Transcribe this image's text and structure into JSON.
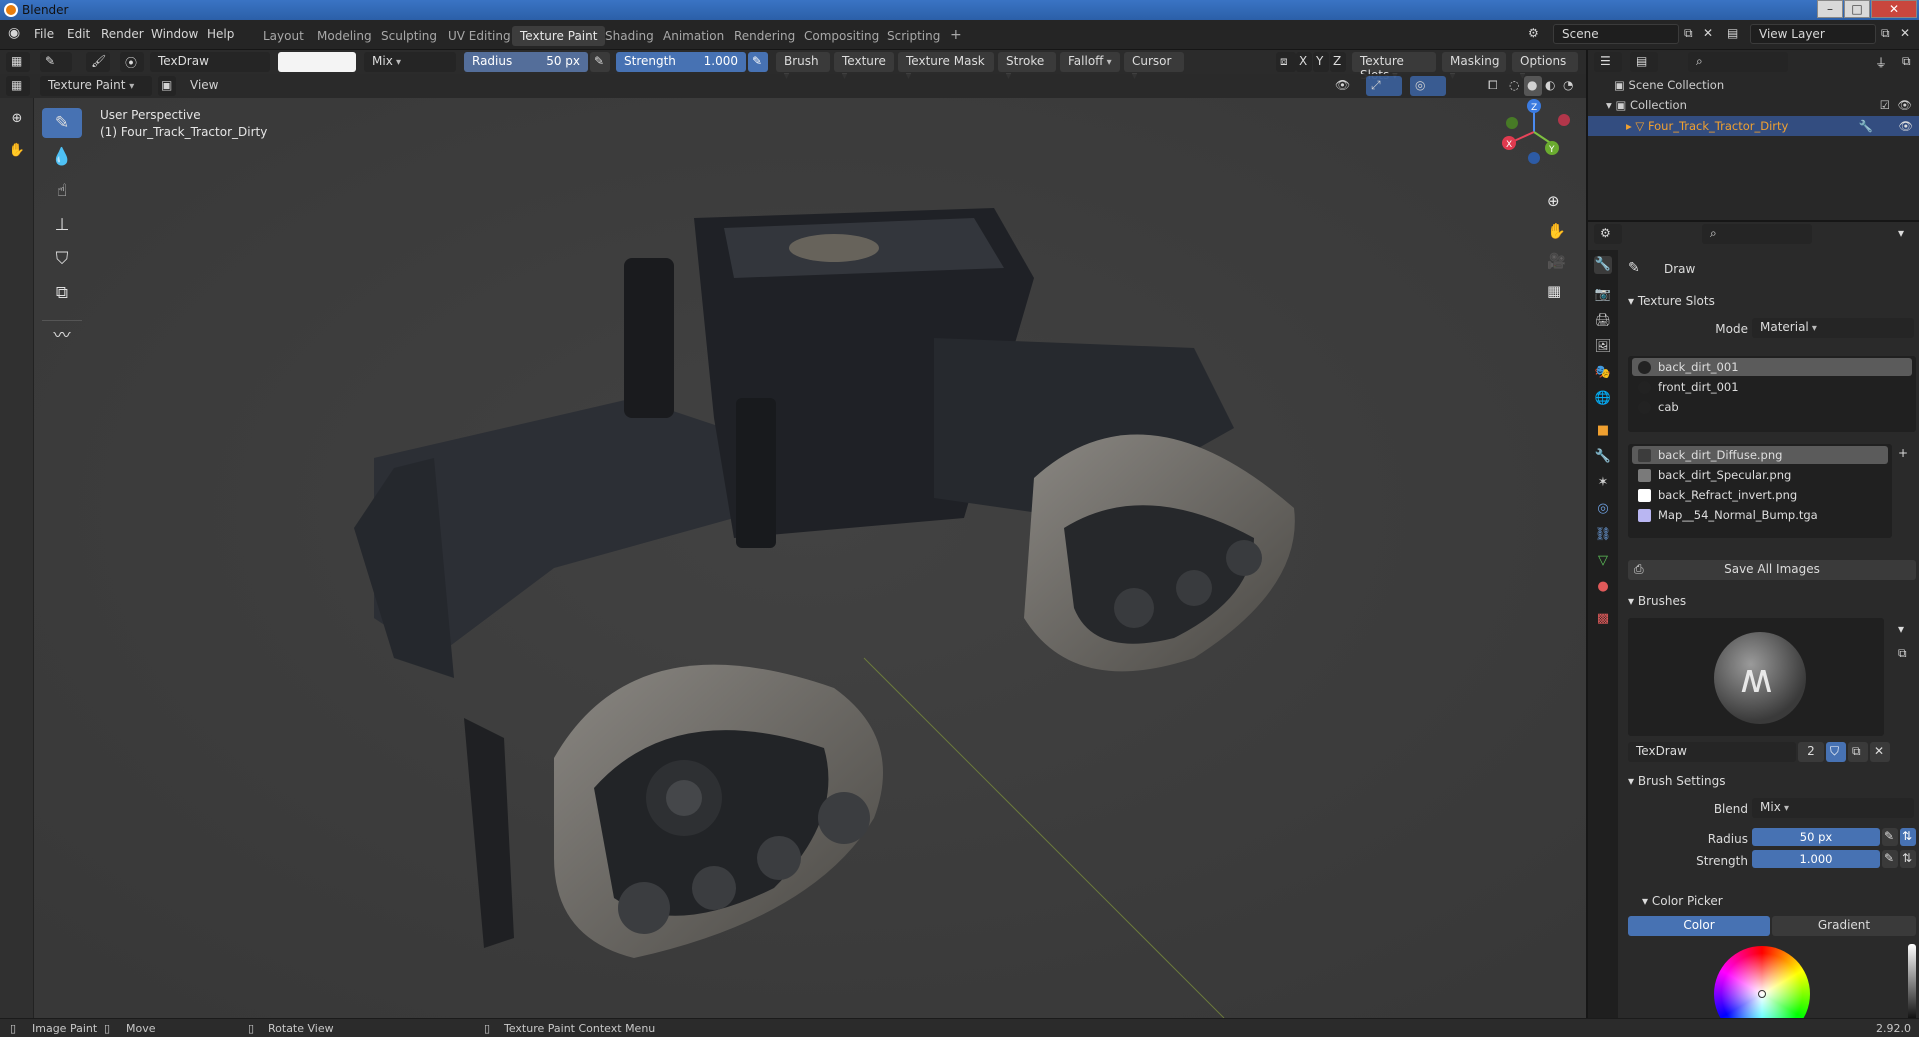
{
  "title": "Blender",
  "menu": {
    "file": "File",
    "edit": "Edit",
    "render": "Render",
    "window": "Window",
    "help": "Help"
  },
  "workspaces": [
    "Layout",
    "Modeling",
    "Sculpting",
    "UV Editing",
    "Texture Paint",
    "Shading",
    "Animation",
    "Rendering",
    "Compositing",
    "Scripting"
  ],
  "scene": "Scene",
  "view_layer": "View Layer",
  "tool_settings": {
    "brush_name": "TexDraw",
    "blend": "Mix",
    "radius_label": "Radius",
    "radius_value": "50 px",
    "strength_label": "Strength",
    "strength_value": "1.000",
    "brush": "Brush",
    "texture": "Texture",
    "texture_mask": "Texture Mask",
    "stroke": "Stroke",
    "falloff": "Falloff",
    "cursor": "Cursor",
    "x": "X",
    "y": "Y",
    "z": "Z",
    "texture_slots": "Texture Slots",
    "masking": "Masking",
    "options": "Options"
  },
  "mode_bar": {
    "mode": "Texture Paint",
    "view": "View"
  },
  "viewport": {
    "perspective": "User Perspective",
    "object": "(1) Four_Track_Tractor_Dirty"
  },
  "outliner": {
    "scene_collection": "Scene Collection",
    "collection": "Collection",
    "object": "Four_Track_Tractor_Dirty"
  },
  "properties": {
    "tool_name": "Draw",
    "texture_slots_header": "Texture Slots",
    "mode_label": "Mode",
    "mode_value": "Material",
    "materials": [
      "back_dirt_001",
      "front_dirt_001",
      "cab"
    ],
    "images": [
      {
        "name": "back_dirt_Diffuse.png",
        "color": "#3c3c3c"
      },
      {
        "name": "back_dirt_Specular.png",
        "color": "#7a7a7a"
      },
      {
        "name": "back_Refract_invert.png",
        "color": "#ffffff"
      },
      {
        "name": "Map__54_Normal_Bump.tga",
        "color": "#b9b6f2"
      }
    ],
    "save_all": "Save All Images",
    "brushes_header": "Brushes",
    "brush_name": "TexDraw",
    "brush_users": "2",
    "brush_settings_header": "Brush Settings",
    "blend_label": "Blend",
    "blend_value": "Mix",
    "radius_label": "Radius",
    "radius_value": "50 px",
    "strength_label": "Strength",
    "strength_value": "1.000",
    "color_picker_header": "Color Picker",
    "color_tab": "Color",
    "gradient_tab": "Gradient"
  },
  "status": {
    "image_paint": "Image Paint",
    "move": "Move",
    "rotate": "Rotate View",
    "context": "Texture Paint Context Menu",
    "version": "2.92.0"
  },
  "colors": {
    "accent": "#4772b3",
    "selected_object": "#f0a030"
  }
}
